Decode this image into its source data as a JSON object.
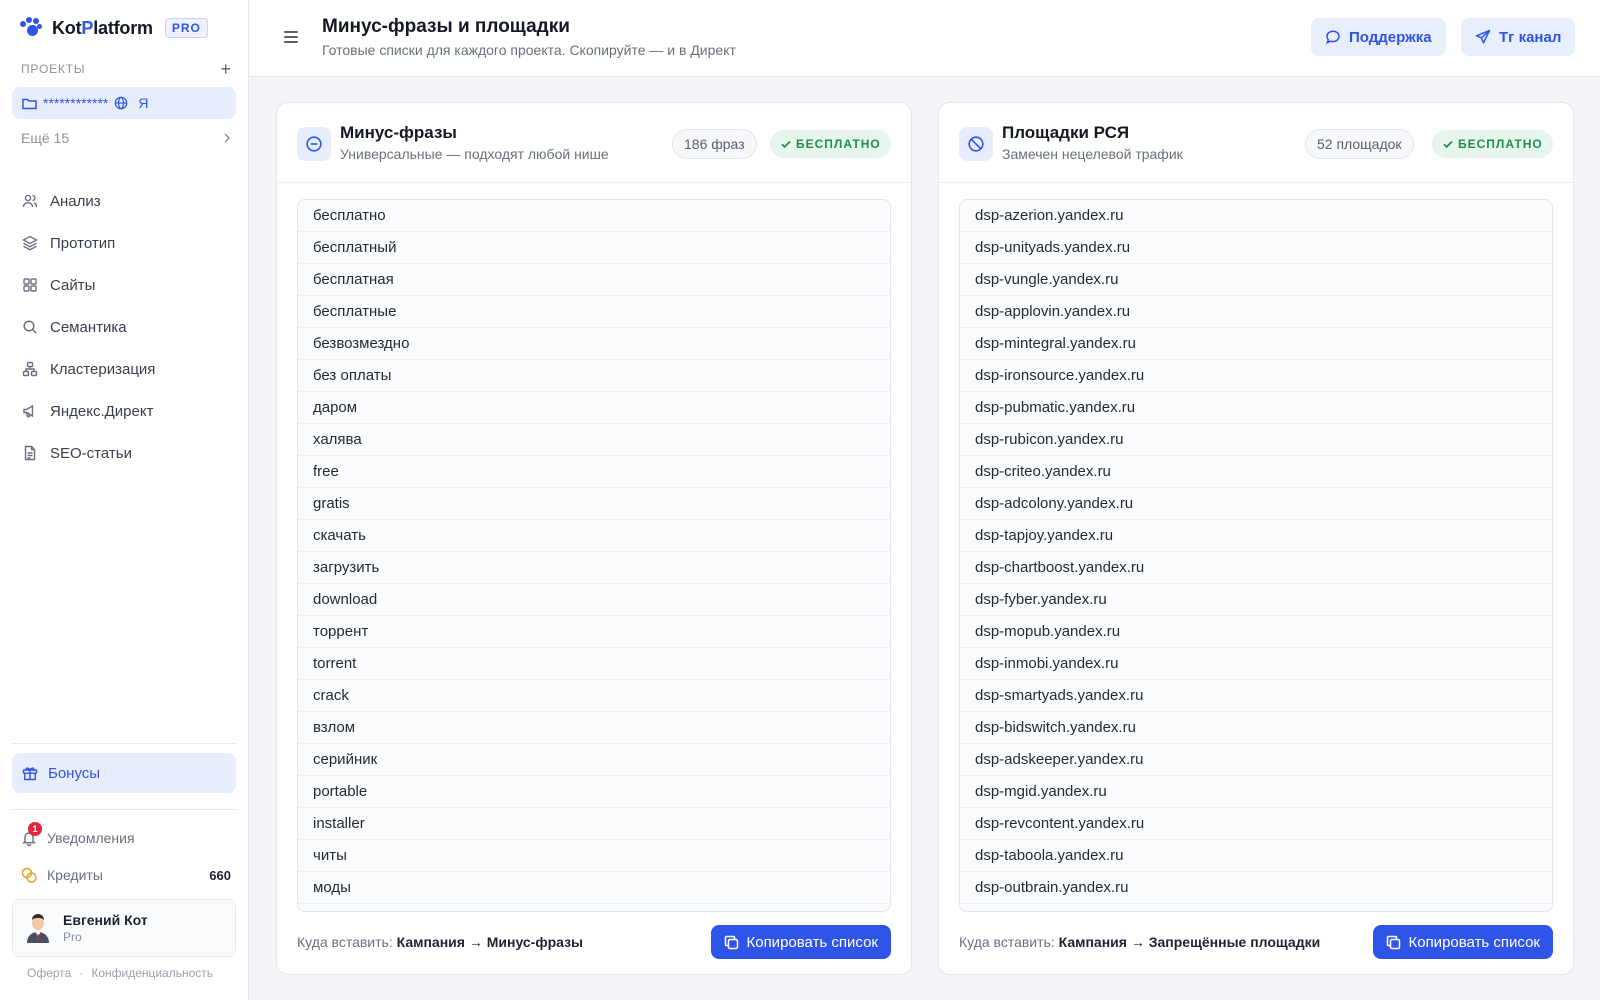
{
  "app": {
    "name_part1": "Kot",
    "name_accent": "P",
    "name_part2": "latform",
    "badge": "PRO"
  },
  "sidebar": {
    "projects_label": "ПРОЕКТЫ",
    "add_icon": "+",
    "current_project": {
      "name": "************",
      "search_engine": "Я"
    },
    "more_label": "Ещё 15",
    "nav": [
      {
        "label": "Анализ",
        "icon": "users-icon"
      },
      {
        "label": "Прототип",
        "icon": "layers-icon"
      },
      {
        "label": "Сайты",
        "icon": "grid-icon"
      },
      {
        "label": "Семантика",
        "icon": "search-icon"
      },
      {
        "label": "Кластеризация",
        "icon": "cluster-icon"
      },
      {
        "label": "Яндекс.Директ",
        "icon": "megaphone-icon"
      },
      {
        "label": "SEO-статьи",
        "icon": "document-icon"
      }
    ],
    "bonus_label": "Бонусы",
    "notifications": {
      "label": "Уведомления",
      "count": "1"
    },
    "credits": {
      "label": "Кредиты",
      "value": "660"
    },
    "user": {
      "name": "Евгений Кот",
      "plan": "Pro"
    },
    "legal": {
      "offer": "Оферта",
      "separator": "·",
      "privacy": "Конфиденциальность"
    }
  },
  "header": {
    "title": "Минус-фразы и площадки",
    "subtitle": "Готовые списки для каждого проекта. Скопируйте — и в Директ",
    "support_label": "Поддержка",
    "tg_label": "Tг канал"
  },
  "cards": [
    {
      "title": "Минус-фразы",
      "subtitle": "Универсальные — подходят любой нише",
      "count": "186 фраз",
      "free_label": "БЕСПЛАТНО",
      "items": [
        "бесплатно",
        "бесплатный",
        "бесплатная",
        "бесплатные",
        "безвозмездно",
        "без оплаты",
        "даром",
        "халява",
        "free",
        "gratis",
        "скачать",
        "загрузить",
        "download",
        "торрент",
        "torrent",
        "crack",
        "взлом",
        "серийник",
        "portable",
        "installer",
        "читы",
        "моды"
      ],
      "where_label": "Куда вставить:",
      "where_value": "Кампания → Минус-фразы",
      "copy_label": "Копировать список"
    },
    {
      "title": "Площадки РСЯ",
      "subtitle": "Замечен нецелевой трафик",
      "count": "52 площадок",
      "free_label": "БЕСПЛАТНО",
      "items": [
        "dsp-azerion.yandex.ru",
        "dsp-unityads.yandex.ru",
        "dsp-vungle.yandex.ru",
        "dsp-applovin.yandex.ru",
        "dsp-mintegral.yandex.ru",
        "dsp-ironsource.yandex.ru",
        "dsp-pubmatic.yandex.ru",
        "dsp-rubicon.yandex.ru",
        "dsp-criteo.yandex.ru",
        "dsp-adcolony.yandex.ru",
        "dsp-tapjoy.yandex.ru",
        "dsp-chartboost.yandex.ru",
        "dsp-fyber.yandex.ru",
        "dsp-mopub.yandex.ru",
        "dsp-inmobi.yandex.ru",
        "dsp-smartyads.yandex.ru",
        "dsp-bidswitch.yandex.ru",
        "dsp-adskeeper.yandex.ru",
        "dsp-mgid.yandex.ru",
        "dsp-revcontent.yandex.ru",
        "dsp-taboola.yandex.ru",
        "dsp-outbrain.yandex.ru"
      ],
      "where_label": "Куда вставить:",
      "where_value": "Кампания → Запрещённые площадки",
      "copy_label": "Копировать список"
    }
  ],
  "colors": {
    "accent": "#2f55e8",
    "accent_soft": "#e8edfd",
    "success": "#1f8f4d",
    "danger": "#e5253a"
  }
}
